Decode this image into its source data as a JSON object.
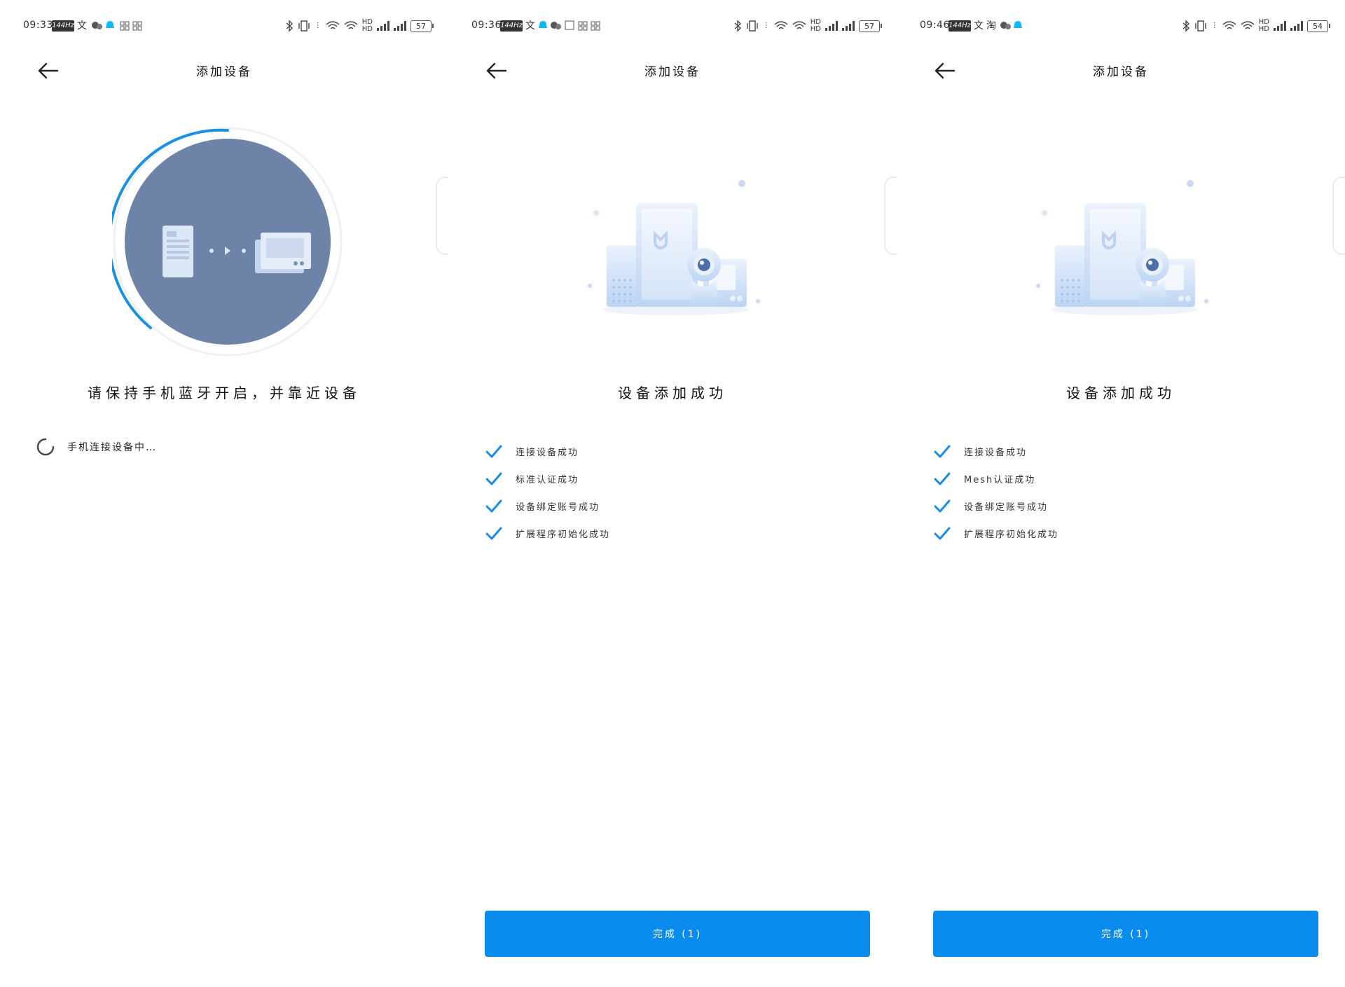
{
  "screens": [
    {
      "status": {
        "time": "09:33",
        "hz": "144Hz",
        "battery": "57"
      },
      "header": {
        "title": "添加设备"
      },
      "headline": "请保持手机蓝牙开启，并靠近设备",
      "connecting_text": "手机连接设备中…"
    },
    {
      "status": {
        "time": "09:36",
        "hz": "144Hz",
        "battery": "57"
      },
      "header": {
        "title": "添加设备"
      },
      "headline": "设备添加成功",
      "steps": [
        "连接设备成功",
        "标准认证成功",
        "设备绑定账号成功",
        "扩展程序初始化成功"
      ],
      "done_label": "完成 (1)"
    },
    {
      "status": {
        "time": "09:46",
        "hz": "144Hz",
        "battery": "54"
      },
      "header": {
        "title": "添加设备"
      },
      "headline": "设备添加成功",
      "steps": [
        "连接设备成功",
        "Mesh认证成功",
        "设备绑定账号成功",
        "扩展程序初始化成功"
      ],
      "done_label": "完成 (1)"
    }
  ],
  "colors": {
    "accent": "#0a8cef",
    "check": "#1a8ce6",
    "circle": "#6d84a8",
    "progress": "#1a90e0"
  },
  "icons": [
    "back-arrow-icon",
    "bluetooth-icon",
    "vibrate-icon",
    "wifi-icon",
    "signal-icon",
    "battery-icon",
    "check-icon",
    "spinner-icon"
  ]
}
